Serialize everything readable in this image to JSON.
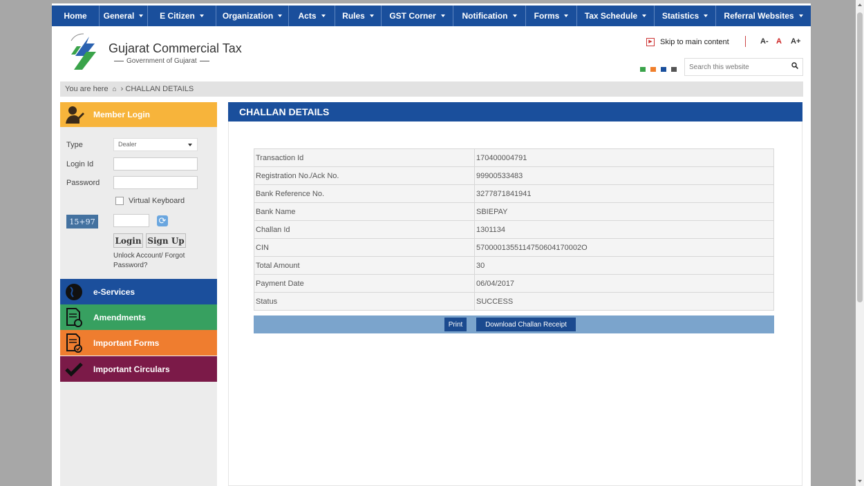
{
  "nav": {
    "items": [
      {
        "label": "Home",
        "caret": false
      },
      {
        "label": "General",
        "caret": true
      },
      {
        "label": "E Citizen",
        "caret": true
      },
      {
        "label": "Organization",
        "caret": true
      },
      {
        "label": "Acts",
        "caret": true
      },
      {
        "label": "Rules",
        "caret": true
      },
      {
        "label": "GST Corner",
        "caret": true
      },
      {
        "label": "Notification",
        "caret": true
      },
      {
        "label": "Forms",
        "caret": true
      },
      {
        "label": "Tax Schedule",
        "caret": true
      },
      {
        "label": "Statistics",
        "caret": true
      },
      {
        "label": "Referral Websites",
        "caret": true
      }
    ]
  },
  "header": {
    "title": "Gujarat Commercial Tax",
    "subtitle": "Government of Gujarat",
    "skip_label": "Skip to main content",
    "font_small": "A-",
    "font_normal": "A",
    "font_large": "A+",
    "search_placeholder": "Search this website",
    "theme_colors": [
      "#3aa34a",
      "#f07f2b",
      "#1a4f9c",
      "#555555"
    ]
  },
  "breadcrumb": {
    "prefix": "You are here",
    "current": "CHALLAN DETAILS"
  },
  "login": {
    "title": "Member Login",
    "type_label": "Type",
    "type_value": "Dealer",
    "login_id_label": "Login Id",
    "password_label": "Password",
    "virtual_keyboard": "Virtual Keyboard",
    "captcha": "15+97",
    "login_button": "Login",
    "signup_button": "Sign Up",
    "unlock_text": "Unlock Account/ Forgot Password?"
  },
  "side_menu": [
    {
      "label": "e-Services",
      "color": "#1b4f9c",
      "icon": "globe-icon"
    },
    {
      "label": "Amendments",
      "color": "#37a060",
      "icon": "document-edit-icon"
    },
    {
      "label": "Important Forms",
      "color": "#ef7d2f",
      "icon": "document-check-icon"
    },
    {
      "label": "Important Circulars",
      "color": "#7b1a48",
      "icon": "checkmark-icon"
    }
  ],
  "content": {
    "title": "CHALLAN DETAILS",
    "rows": [
      {
        "label": "Transaction Id",
        "value": "170400004791"
      },
      {
        "label": "Registration No./Ack No.",
        "value": "99900533483"
      },
      {
        "label": "Bank Reference No.",
        "value": "3277871841941"
      },
      {
        "label": "Bank Name",
        "value": "SBIEPAY"
      },
      {
        "label": "Challan Id",
        "value": "1301134"
      },
      {
        "label": "CIN",
        "value": "5700001355114750604170002O"
      },
      {
        "label": "Total Amount",
        "value": "30"
      },
      {
        "label": "Payment Date",
        "value": "06/04/2017"
      },
      {
        "label": "Status",
        "value": "SUCCESS"
      }
    ],
    "print_label": "Print",
    "download_label": "Download Challan Receipt"
  }
}
